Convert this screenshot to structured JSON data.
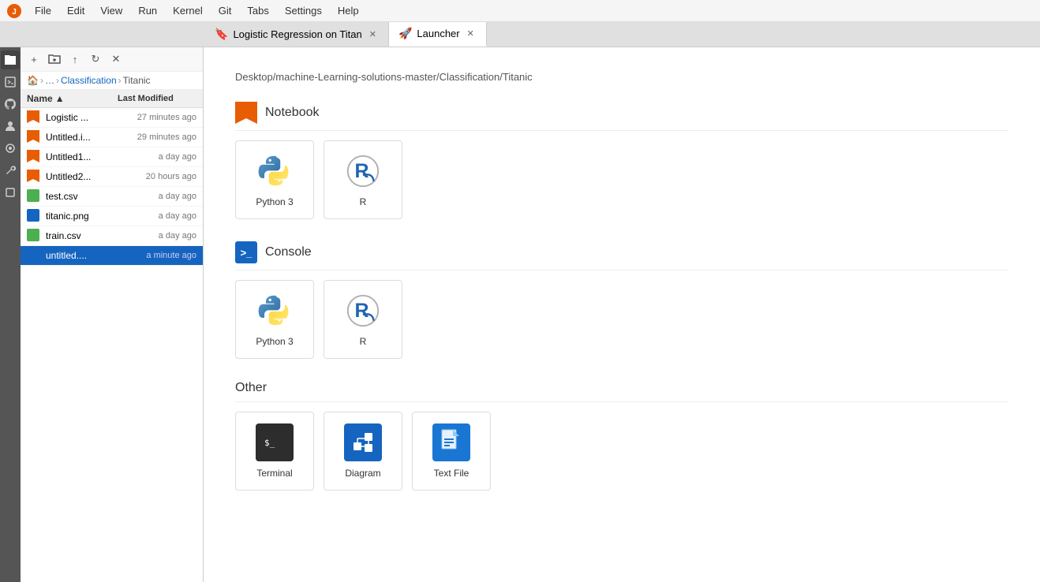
{
  "menubar": {
    "items": [
      "File",
      "Edit",
      "View",
      "Run",
      "Kernel",
      "Git",
      "Tabs",
      "Settings",
      "Help"
    ]
  },
  "tabs": [
    {
      "label": "Logistic Regression on Titan",
      "type": "notebook",
      "active": false
    },
    {
      "label": "Launcher",
      "type": "launcher",
      "active": true
    }
  ],
  "sidebar": {
    "breadcrumb": [
      "…",
      "Classification",
      "Titanic"
    ],
    "columns": {
      "name": "Name",
      "modified": "Last Modified"
    },
    "files": [
      {
        "name": "Logistic ...",
        "modified": "27 minutes ago",
        "type": "notebook"
      },
      {
        "name": "Untitled.i...",
        "modified": "29 minutes ago",
        "type": "notebook"
      },
      {
        "name": "Untitled1...",
        "modified": "a day ago",
        "type": "notebook"
      },
      {
        "name": "Untitled2...",
        "modified": "20 hours ago",
        "type": "notebook"
      },
      {
        "name": "test.csv",
        "modified": "a day ago",
        "type": "csv"
      },
      {
        "name": "titanic.png",
        "modified": "a day ago",
        "type": "png"
      },
      {
        "name": "train.csv",
        "modified": "a day ago",
        "type": "csv"
      },
      {
        "name": "untitled....",
        "modified": "a minute ago",
        "type": "untitled",
        "selected": true
      }
    ]
  },
  "launcher": {
    "path": "Desktop/machine-Learning-solutions-master/Classification/Titanic",
    "sections": {
      "notebook": {
        "title": "Notebook",
        "items": [
          {
            "label": "Python 3",
            "type": "python"
          },
          {
            "label": "R",
            "type": "r"
          }
        ]
      },
      "console": {
        "title": "Console",
        "items": [
          {
            "label": "Python 3",
            "type": "python"
          },
          {
            "label": "R",
            "type": "r"
          }
        ]
      },
      "other": {
        "title": "Other",
        "items": [
          {
            "label": "Terminal",
            "type": "terminal"
          },
          {
            "label": "Diagram",
            "type": "diagram"
          },
          {
            "label": "Text File",
            "type": "textfile"
          }
        ]
      }
    }
  }
}
